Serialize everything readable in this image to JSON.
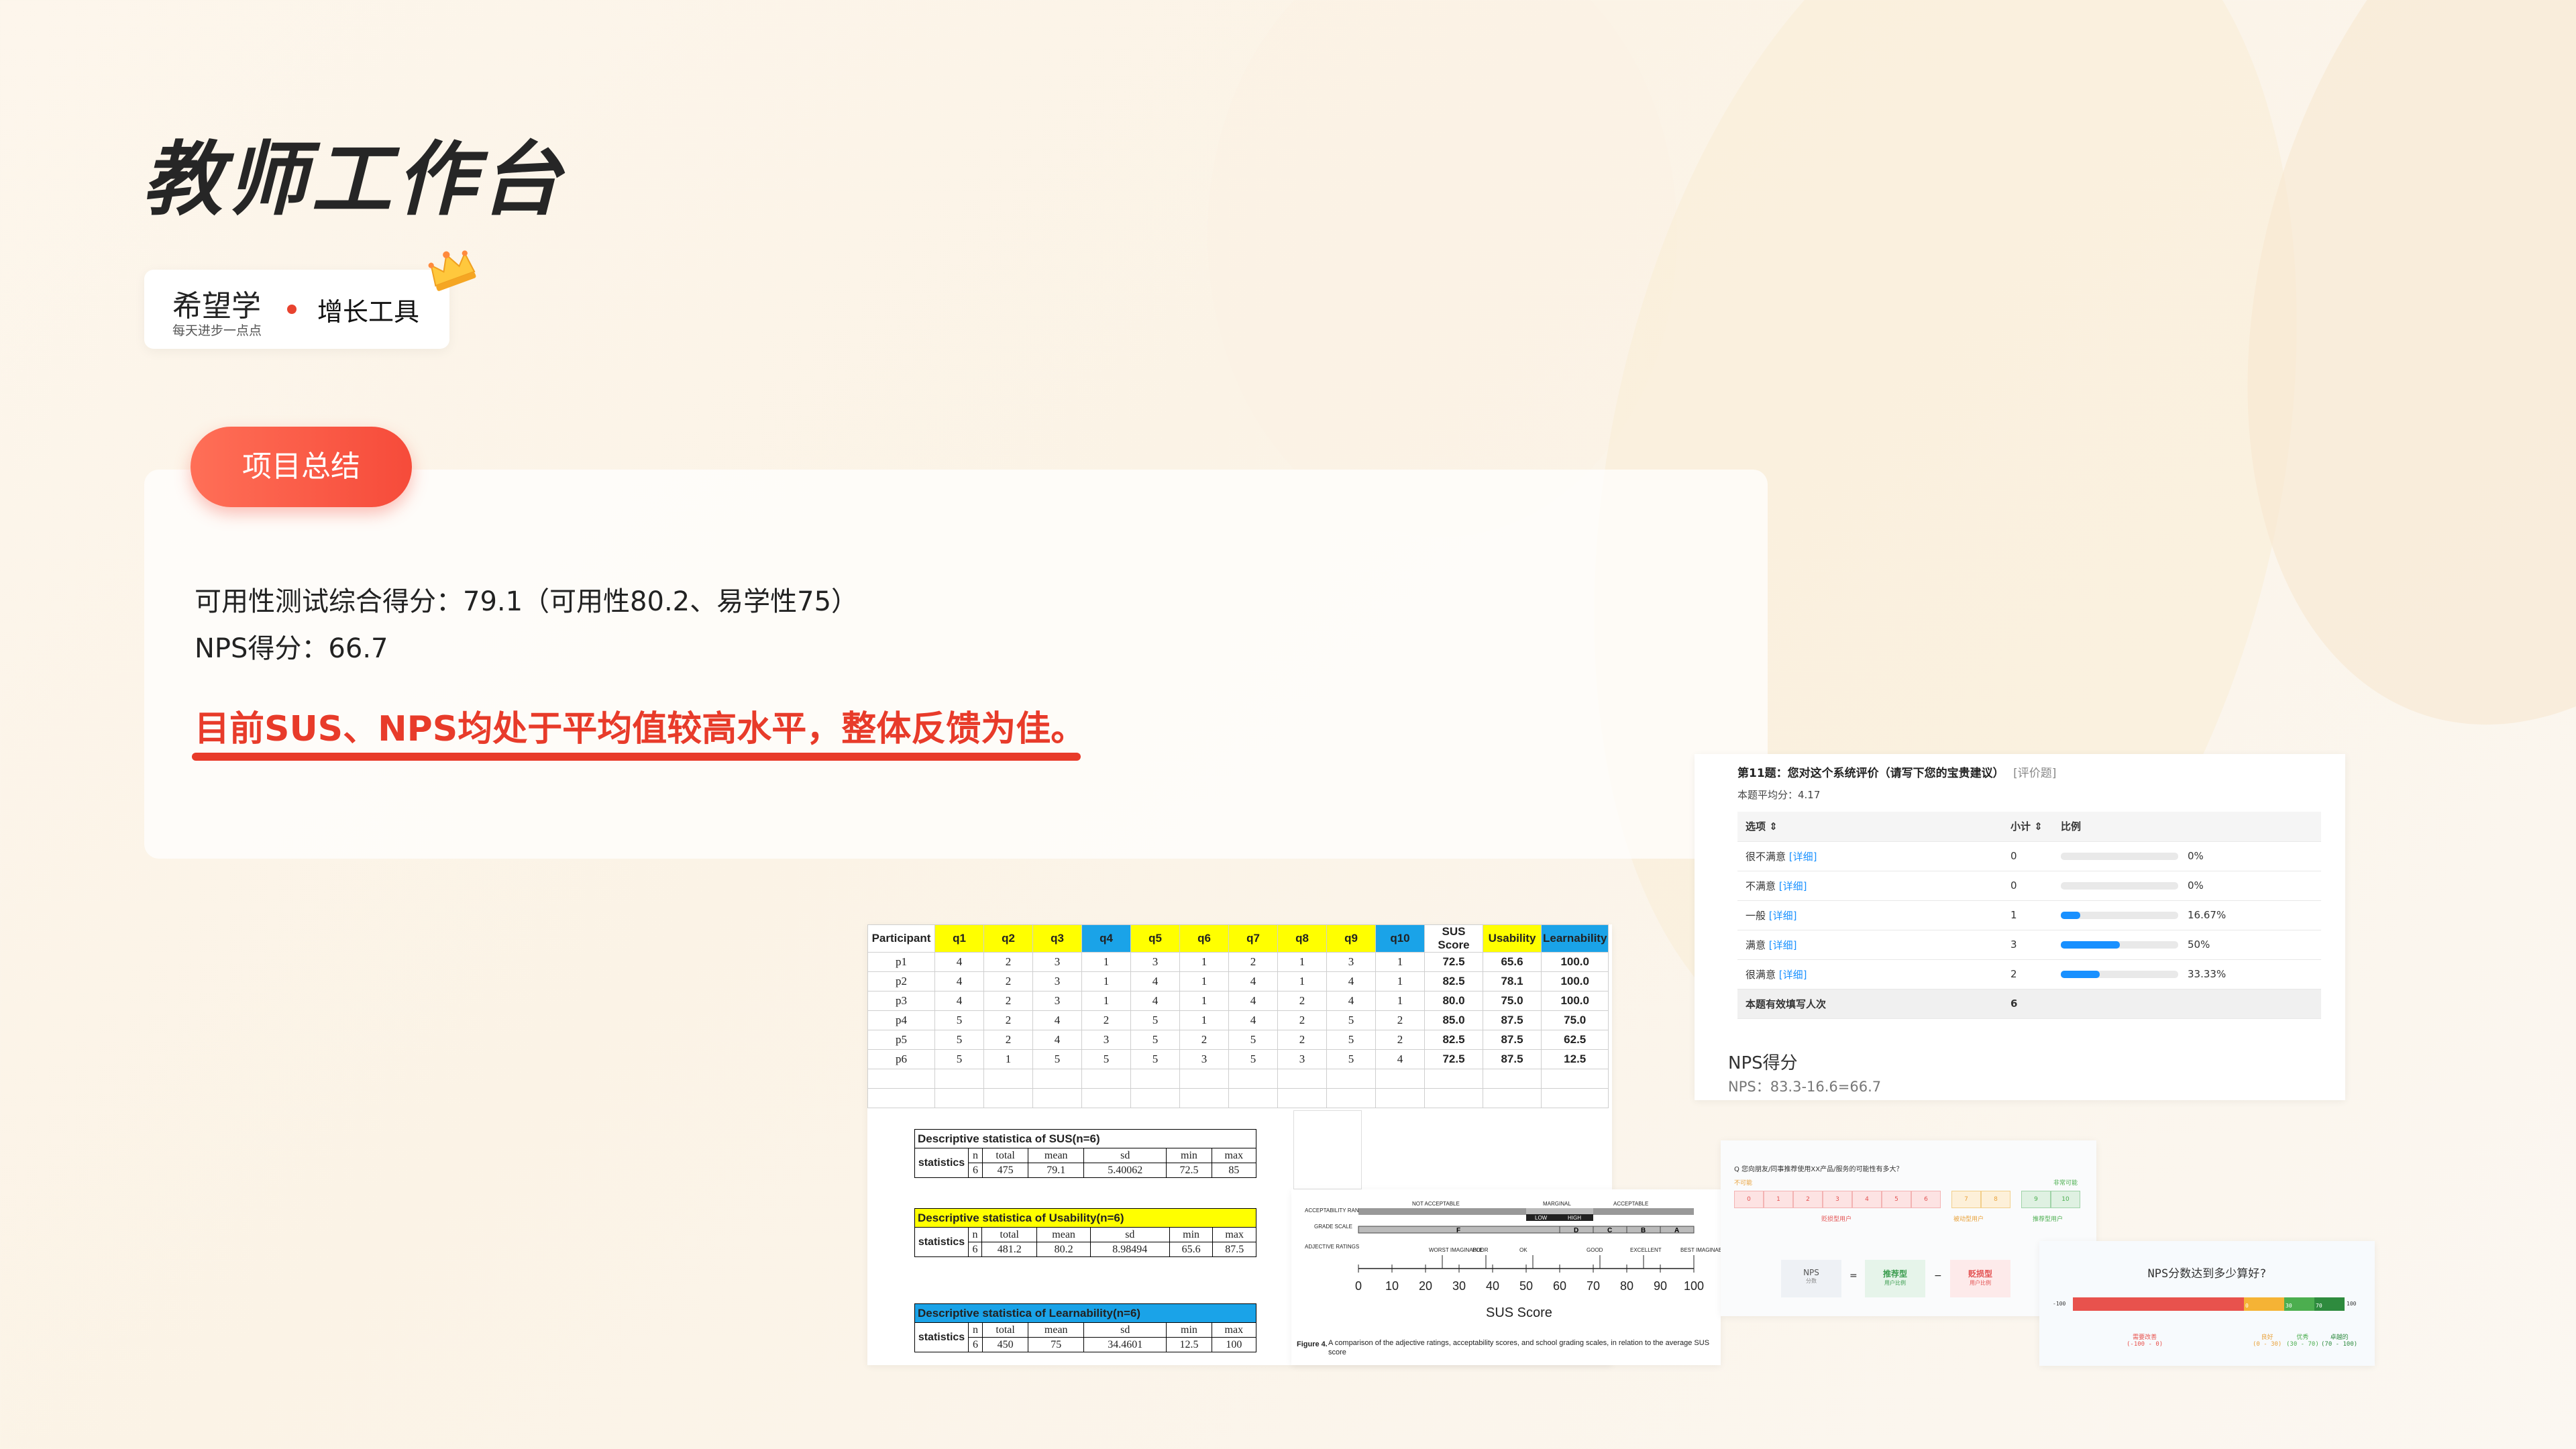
{
  "page": {
    "title": "教师工作台"
  },
  "brand": {
    "logo": "希望学",
    "slogan": "每天进步一点点",
    "tool": "增长工具"
  },
  "summary": {
    "tag": "项目总结",
    "line1": "可用性测试综合得分：79.1（可用性80.2、易学性75）",
    "line2": "NPS得分：66.7",
    "highlight": "目前SUS、NPS均处于平均值较高水平，整体反馈为佳。"
  },
  "spreadsheet": {
    "headers": [
      "Participant",
      "q1",
      "q2",
      "q3",
      "q4",
      "q5",
      "q6",
      "q7",
      "q8",
      "q9",
      "q10",
      "SUS Score",
      "Usability",
      "Learnability"
    ],
    "rows": [
      [
        "p1",
        "4",
        "2",
        "3",
        "1",
        "3",
        "1",
        "2",
        "1",
        "3",
        "1",
        "72.5",
        "65.6",
        "100.0"
      ],
      [
        "p2",
        "4",
        "2",
        "3",
        "1",
        "4",
        "1",
        "4",
        "1",
        "4",
        "1",
        "82.5",
        "78.1",
        "100.0"
      ],
      [
        "p3",
        "4",
        "2",
        "3",
        "1",
        "4",
        "1",
        "4",
        "2",
        "4",
        "1",
        "80.0",
        "75.0",
        "100.0"
      ],
      [
        "p4",
        "5",
        "2",
        "4",
        "2",
        "5",
        "1",
        "4",
        "2",
        "5",
        "2",
        "85.0",
        "87.5",
        "75.0"
      ],
      [
        "p5",
        "5",
        "2",
        "4",
        "3",
        "5",
        "2",
        "5",
        "2",
        "5",
        "2",
        "82.5",
        "87.5",
        "62.5"
      ],
      [
        "p6",
        "5",
        "1",
        "5",
        "5",
        "5",
        "3",
        "5",
        "3",
        "5",
        "4",
        "72.5",
        "87.5",
        "12.5"
      ]
    ],
    "stat_cols": [
      "n",
      "total",
      "mean",
      "sd",
      "min",
      "max"
    ],
    "stat_label": "statistics",
    "descriptives": [
      {
        "title": "Descriptive statistica of SUS(n=6)",
        "values": [
          "6",
          "475",
          "79.1",
          "5.40062",
          "72.5",
          "85"
        ]
      },
      {
        "title": "Descriptive statistica of Usability(n=6)",
        "values": [
          "6",
          "481.2",
          "80.2",
          "8.98494",
          "65.6",
          "87.5"
        ]
      },
      {
        "title": "Descriptive statistica of Learnability(n=6)",
        "values": [
          "6",
          "450",
          "75",
          "34.4601",
          "12.5",
          "100"
        ]
      }
    ]
  },
  "sus_figure": {
    "acceptability_label": "ACCEPTABILITY RANGES",
    "grade_label": "GRADE SCALE",
    "adjective_label": "ADJECTIVE RATINGS",
    "not_acceptable": "NOT ACCEPTABLE",
    "marginal": "MARGINAL",
    "low": "LOW",
    "high": "HIGH",
    "acceptable": "ACCEPTABLE",
    "grades": [
      "F",
      "D",
      "C",
      "B",
      "A"
    ],
    "adjectives": [
      "WORST IMAGINABLE",
      "POOR",
      "OK",
      "GOOD",
      "EXCELLENT",
      "BEST IMAGINABLE"
    ],
    "ticks": [
      "0",
      "10",
      "20",
      "30",
      "40",
      "50",
      "60",
      "70",
      "80",
      "90",
      "100"
    ],
    "axis_label": "SUS Score",
    "caption_bold": "Figure 4.",
    "caption": " A comparison of the adjective ratings, acceptability scores, and school grading scales, in relation to the average SUS score"
  },
  "survey": {
    "question": "第11题：您对这个系统评价（请写下您的宝贵建议）",
    "tag": "[评价题]",
    "avg_label": "本题平均分：4.17",
    "col_option": "选项 ⇕",
    "col_count": "小计 ⇕",
    "col_ratio": "比例",
    "detail": "[详细]",
    "rows": [
      {
        "option": "很不满意",
        "count": "0",
        "ratio": "0%",
        "pct": 0
      },
      {
        "option": "不满意",
        "count": "0",
        "ratio": "0%",
        "pct": 0
      },
      {
        "option": "一般",
        "count": "1",
        "ratio": "16.67%",
        "pct": 16.67
      },
      {
        "option": "满意",
        "count": "3",
        "ratio": "50%",
        "pct": 50
      },
      {
        "option": "很满意",
        "count": "2",
        "ratio": "33.33%",
        "pct": 33.33
      }
    ],
    "total_label": "本题有效填写人次",
    "total": "6",
    "nps_title": "NPS得分",
    "nps_formula": "NPS：83.3-16.6=66.7"
  },
  "nps_question": {
    "question": "Q 您向朋友/同事推荐使用XX产品/服务的可能性有多大？",
    "low_hint": "不可能",
    "high_hint": "非常可能",
    "scale": [
      "0",
      "1",
      "2",
      "3",
      "4",
      "5",
      "6",
      "7",
      "8",
      "9",
      "10"
    ],
    "detractors": "贬损型用户",
    "passives": "被动型用户",
    "promoters": "推荐型用户",
    "nps": "NPS",
    "nps_sub": "分数",
    "equals": "=",
    "minus": "−",
    "promoter_box": "推荐型",
    "promoter_sub": "用户比例",
    "detractor_box": "贬损型",
    "detractor_sub": "用户比例"
  },
  "nps_scale": {
    "title": "NPS分数达到多少算好?",
    "ends": [
      "-100",
      "100"
    ],
    "marks": [
      "0",
      "30",
      "70"
    ],
    "bands": [
      {
        "name": "需要改善",
        "range": "(-100 - 0)"
      },
      {
        "name": "良好",
        "range": "(0 - 30)"
      },
      {
        "name": "优秀",
        "range": "(30 - 70)"
      },
      {
        "name": "卓越的",
        "range": "(70 - 100)"
      }
    ]
  },
  "colors": {
    "accent": "#e83b2a",
    "pill": "#f64b3a",
    "highlight_yellow": "#ffff00",
    "highlight_blue": "#1aa3e8",
    "survey_bar": "#1890ff"
  }
}
